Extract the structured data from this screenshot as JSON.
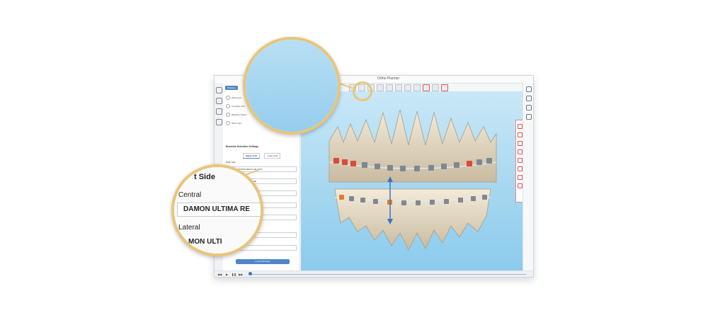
{
  "window": {
    "title": "Ortho Planner"
  },
  "left_panel": {
    "tag": "Brackets",
    "rows": [
      {
        "label": "Placement"
      },
      {
        "label": "Compare with"
      },
      {
        "label": "Brackets Library"
      },
      {
        "label": "Show Ligs"
      }
    ],
    "section_title": "Brackets Selection Settings",
    "tabs": [
      {
        "label": "Upper Arch"
      },
      {
        "label": "Lower Arch"
      }
    ],
    "subsection": "Right Side",
    "fields": [
      {
        "value": "DAMON ULTIMA REGULAR (.022)"
      },
      {
        "value": "DAMON ULTIMA REGULAR"
      },
      {
        "value": "DAMON ULTIMA REGULAR"
      },
      {
        "value": "DAMON ULTIMA REGULAR (.022)"
      },
      {
        "value": "DAMON ULTIMA REGULAR (.022)"
      },
      {
        "value": "DAMON ULTIMA REGULAR"
      },
      {
        "value": "NETTEN"
      }
    ],
    "action_button": "Locate Brackets"
  },
  "zoom_detail": {
    "side_label": "t Side",
    "central_label": "Central",
    "central_value": "DAMON ULTIMA RE",
    "lateral_label": "Lateral",
    "lateral_value": "MON ULTI"
  },
  "colors": {
    "accent": "#4f86c6",
    "callout": "#e8c578",
    "viewport_top": "#c9e8f7",
    "viewport_bottom": "#8ccbed",
    "bracket_red": "#d94a3a",
    "bracket_orange": "#e17d2c"
  },
  "icons": [
    "brush-icon",
    "list-icon",
    "tooth-icon",
    "settings-icon",
    "play-icon",
    "pause-icon",
    "step-forward-icon",
    "step-back-icon"
  ]
}
